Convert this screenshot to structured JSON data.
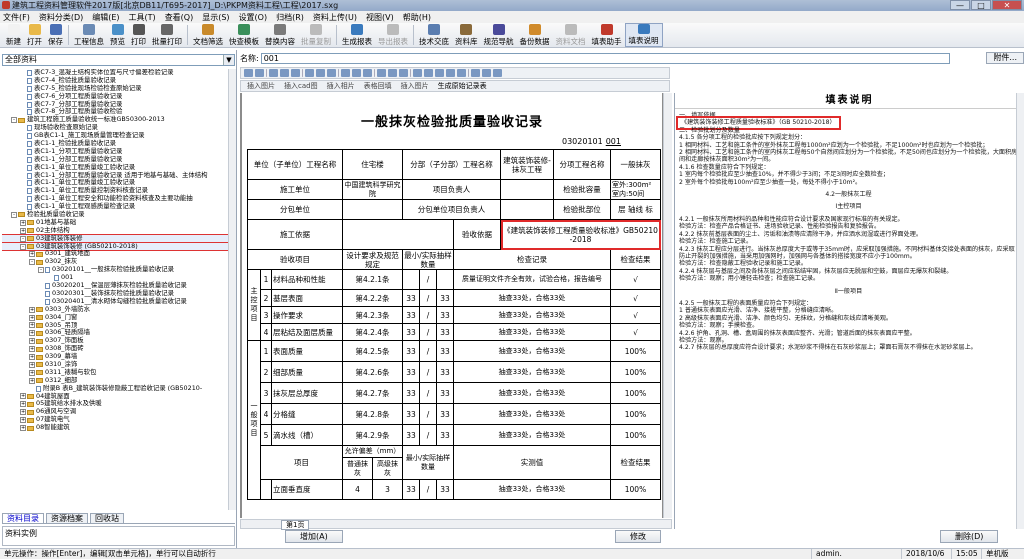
{
  "window": {
    "title": "建筑工程资料管理软件2017版[北京DB11/T695-2017]_D:\\PKPM资料工程\\工程\\2017.sxg",
    "min": "—",
    "max": "□",
    "close": "✕"
  },
  "menu": [
    "文件(F)",
    "资料分类(D)",
    "编辑(E)",
    "工具(T)",
    "查看(Q)",
    "显示(S)",
    "设置(O)",
    "归档(R)",
    "资料上传(U)",
    "视图(V)",
    "帮助(H)"
  ],
  "toolbar": [
    {
      "label": "新建",
      "color": "#f2f2f2"
    },
    {
      "label": "打开",
      "color": "#e9b949"
    },
    {
      "label": "保存",
      "color": "#4a6fb5"
    },
    {
      "sep": true
    },
    {
      "label": "工程信息",
      "color": "#6b8bb5"
    },
    {
      "label": "预览",
      "color": "#4a90c8"
    },
    {
      "label": "打印",
      "color": "#555"
    },
    {
      "label": "批量打印",
      "color": "#666"
    },
    {
      "sep": true
    },
    {
      "label": "文档筛选",
      "color": "#c98a2a"
    },
    {
      "label": "快查模板",
      "color": "#3a8f5a"
    },
    {
      "label": "替换内容",
      "color": "#7a7a7a"
    },
    {
      "label": "批量复制",
      "color": "#bbb",
      "dis": true
    },
    {
      "sep": true
    },
    {
      "label": "生成报表",
      "color": "#3a7abd"
    },
    {
      "label": "导出报表",
      "color": "#bbb",
      "dis": true
    },
    {
      "sep": true
    },
    {
      "label": "技术交底",
      "color": "#5a7db0"
    },
    {
      "label": "资料库",
      "color": "#8a6a3a"
    },
    {
      "label": "规范导航",
      "color": "#4a4a9a"
    },
    {
      "label": "备份数据",
      "color": "#d08a2a"
    },
    {
      "label": "资料文档",
      "color": "#bbb",
      "dis": true
    },
    {
      "label": "填表助手",
      "color": "#c0392b"
    },
    {
      "label": "填表说明",
      "color": "#3a7abd",
      "active": true
    }
  ],
  "left": {
    "combo": "全部资料",
    "tree": [
      {
        "i": 2,
        "t": "表C7-3_混凝土结构实体位置与尺寸偏差检验记录",
        "k": "dc"
      },
      {
        "i": 2,
        "t": "表C7-4_检验批质量验收记录",
        "k": "dc"
      },
      {
        "i": 2,
        "t": "表C7-5_检验批现场检验检查原始记录",
        "k": "dc"
      },
      {
        "i": 2,
        "t": "表C7-6_分项工程质量验收记录",
        "k": "dc"
      },
      {
        "i": 2,
        "t": "表C7-7_分部工程质量验收记录",
        "k": "dc"
      },
      {
        "i": 2,
        "t": "表C7-8_分部工程质量验收检验",
        "k": "dc"
      },
      {
        "i": 1,
        "t": "建筑工程施工质量验收统一标准GB50300-2013",
        "k": "fd",
        "pm": "-"
      },
      {
        "i": 2,
        "t": "现场验收检查原始记录",
        "k": "dc"
      },
      {
        "i": 2,
        "t": "GB表C1-1_施工现场质量管理检查记录",
        "k": "dc"
      },
      {
        "i": 2,
        "t": "表C1-1_检验批质量验收记录",
        "k": "dc"
      },
      {
        "i": 2,
        "t": "表C1-1_分项工程质量验收记录",
        "k": "dc"
      },
      {
        "i": 2,
        "t": "表C1-1_分部工程质量验收记录",
        "k": "dc"
      },
      {
        "i": 2,
        "t": "表C1-1_单位工程质量竣工验收记录",
        "k": "dc"
      },
      {
        "i": 2,
        "t": "表C1-1_分部工程质量验收记录 适用于地基与基础、主体结构",
        "k": "dc"
      },
      {
        "i": 2,
        "t": "表C1-1_单位工程质量竣工验收记录",
        "k": "dc"
      },
      {
        "i": 2,
        "t": "表C1-1_单位工程质量控制资料核查记录",
        "k": "dc"
      },
      {
        "i": 2,
        "t": "表C1-1_单位工程安全和功能检验资料核查及主要功能抽",
        "k": "dc"
      },
      {
        "i": 2,
        "t": "表C1-1_单位工程观感质量检查记录",
        "k": "dc"
      },
      {
        "i": 1,
        "t": "检验批质量验收记录",
        "k": "fd",
        "pm": "-"
      },
      {
        "i": 2,
        "t": "01地基与基础",
        "k": "fd",
        "pm": "+"
      },
      {
        "i": 2,
        "t": "02主体结构",
        "k": "fd",
        "pm": "+"
      },
      {
        "i": 2,
        "t": "03建筑装饰装修",
        "k": "fd",
        "pm": "-",
        "sel": true
      },
      {
        "i": 2,
        "t": "03建筑装饰装修 (GB50210-2018)",
        "k": "fd",
        "pm": "-",
        "sel": true
      },
      {
        "i": 3,
        "t": "0301_建筑地面",
        "k": "fd",
        "pm": "+"
      },
      {
        "i": 3,
        "t": "0302_抹灰",
        "k": "fd",
        "pm": "-"
      },
      {
        "i": 4,
        "t": "03020101__一般抹灰检验批质量验收记录",
        "k": "dc",
        "pm": "-"
      },
      {
        "i": 5,
        "t": "001",
        "k": "dc"
      },
      {
        "i": 4,
        "t": "03020201__保温层薄抹灰检验批质量验收记录",
        "k": "dc"
      },
      {
        "i": 4,
        "t": "03020301__装饰抹灰检验批质量验收记录",
        "k": "dc"
      },
      {
        "i": 4,
        "t": "03020401__清水砌体勾缝检验批质量验收记录",
        "k": "dc"
      },
      {
        "i": 3,
        "t": "0303_外墙防水",
        "k": "fd",
        "pm": "+"
      },
      {
        "i": 3,
        "t": "0304_门窗",
        "k": "fd",
        "pm": "+"
      },
      {
        "i": 3,
        "t": "0305_吊顶",
        "k": "fd",
        "pm": "+"
      },
      {
        "i": 3,
        "t": "0306_轻质隔墙",
        "k": "fd",
        "pm": "+"
      },
      {
        "i": 3,
        "t": "0307_饰面板",
        "k": "fd",
        "pm": "+"
      },
      {
        "i": 3,
        "t": "0308_饰面砖",
        "k": "fd",
        "pm": "+"
      },
      {
        "i": 3,
        "t": "0309_幕墙",
        "k": "fd",
        "pm": "+"
      },
      {
        "i": 3,
        "t": "0310_涂饰",
        "k": "fd",
        "pm": "+"
      },
      {
        "i": 3,
        "t": "0311_裱糊与软包",
        "k": "fd",
        "pm": "+"
      },
      {
        "i": 3,
        "t": "0312_细部",
        "k": "fd",
        "pm": "+"
      },
      {
        "i": 3,
        "t": "附录B 表B_建筑装饰装修隐蔽工程验收记录 (GB50210-",
        "k": "dc"
      },
      {
        "i": 2,
        "t": "04建筑屋面",
        "k": "fd",
        "pm": "+"
      },
      {
        "i": 2,
        "t": "05建筑给水排水及供暖",
        "k": "fd",
        "pm": "+"
      },
      {
        "i": 2,
        "t": "06通风与空调",
        "k": "fd",
        "pm": "+"
      },
      {
        "i": 2,
        "t": "07建筑电气",
        "k": "fd",
        "pm": "+"
      },
      {
        "i": 2,
        "t": "08智能建筑",
        "k": "fd",
        "pm": "+"
      }
    ],
    "tabs": [
      "资料目录",
      "资源档案",
      "回收站"
    ],
    "panel_title": "资料实例"
  },
  "name_row": {
    "label": "名称:",
    "value": "001",
    "attach": "附件..."
  },
  "form_tools": {
    "gen_label": "生成原始记录表",
    "items": [
      "插入图片",
      "插入cad图",
      "插入相片",
      "表格回填",
      "插入图片"
    ]
  },
  "form": {
    "title": "一般抹灰检验批质量验收记录",
    "code": "03020101",
    "serial": "001",
    "r1": {
      "unit_label": "单位（子单位）工程名称",
      "unit_value": "住宅楼",
      "part_label": "分部（子分部）工程名称",
      "part_value": "建筑装饰装修-抹灰工程",
      "item_label": "分项工程名称",
      "item_value": "一般抹灰"
    },
    "r2": {
      "contractor_label": "施工单位",
      "contractor_value": "中国建筑科学研究院",
      "pm_label": "项目负责人",
      "capacity_label": "检验批容量",
      "capacity_value": "室外:300m²  室内:50间"
    },
    "r3": {
      "sub_label": "分包单位",
      "sub_pm_label": "分包单位项目负责人",
      "pos_label": "检验批部位",
      "pos_value": "层  轴线  标"
    },
    "r4": {
      "basis_label": "施工依据",
      "accept_label": "验收依据",
      "accept_value": "《建筑装饰装修工程质量验收标准》GB50210-2018"
    },
    "head": {
      "item": "验收项目",
      "req": "设计要求及规范规定",
      "min": "最小/实际抽样数量",
      "record": "检查记录",
      "result": "检查结果"
    },
    "main_label": "主控项目",
    "gen_label": "一般项目",
    "main_rows": [
      {
        "n": "1",
        "name": "材料品种和性能",
        "clause": "第4.2.1条",
        "min": "",
        "act": "",
        "record": "质量证明文件齐全有效，试验合格，报告编号",
        "res": "√"
      },
      {
        "n": "2",
        "name": "基层表面",
        "clause": "第4.2.2条",
        "min": "33",
        "act": "33",
        "record": "抽查33处，合格33处",
        "res": "√"
      },
      {
        "n": "3",
        "name": "操作要求",
        "clause": "第4.2.3条",
        "min": "33",
        "act": "33",
        "record": "抽查33处，合格33处",
        "res": "√"
      },
      {
        "n": "4",
        "name": "层粘结及面层质量",
        "clause": "第4.2.4条",
        "min": "33",
        "act": "33",
        "record": "抽查33处，合格33处",
        "res": "√"
      }
    ],
    "gen_rows": [
      {
        "n": "1",
        "name": "表面质量",
        "clause": "第4.2.5条",
        "min": "33",
        "act": "33",
        "record": "抽查33处，合格33处",
        "res": "100%"
      },
      {
        "n": "2",
        "name": "细部质量",
        "clause": "第4.2.6条",
        "min": "33",
        "act": "33",
        "record": "抽查33处，合格33处",
        "res": "100%"
      },
      {
        "n": "3",
        "name": "抹灰层总厚度",
        "clause": "第4.2.7条",
        "min": "33",
        "act": "33",
        "record": "抽查33处，合格33处",
        "res": "100%"
      },
      {
        "n": "4",
        "name": "分格缝",
        "clause": "第4.2.8条",
        "min": "33",
        "act": "33",
        "record": "抽查33处，合格33处",
        "res": "100%"
      },
      {
        "n": "5",
        "name": "滴水线（槽）",
        "clause": "第4.2.9条",
        "min": "33",
        "act": "33",
        "record": "抽查33处，合格33处",
        "res": "100%"
      }
    ],
    "sub_head": {
      "item": "项目",
      "dev": "允许偏差（mm）",
      "normal": "普通抹灰",
      "high": "高级抹灰",
      "min": "最小/实际抽样数量",
      "measured": "实测值",
      "result": "检查结果"
    },
    "last_row": {
      "name": "立面垂直度",
      "normal": "4",
      "high": "3",
      "min": "33",
      "act": "33",
      "record": "抽查33处，合格33处",
      "res": "100%"
    }
  },
  "sheet_tab": "第1页",
  "help": {
    "title": "填表说明",
    "lines": [
      {
        "t": "一、填写依据",
        "c": ""
      },
      {
        "t": "《建筑装饰装修工程质量验收标准》（GB 50210-2018）",
        "c": "red"
      },
      {
        "t": "二、检验批划分及数量",
        "c": ""
      },
      {
        "t": "4.1.5 各分项工程的检验批应按下列规定划分：",
        "c": ""
      },
      {
        "t": "  1 相同材料、工艺和施工条件的室外抹灰工程每1000m²应划为一个检验批，不足1000m²时也应划为一个检验批；",
        "c": ""
      },
      {
        "t": "  2 相同材料、工艺和施工条件的室内抹灰工程每50个自然间应划分为一个检验批，不足50间也应划分为一个检验批，大面积房间和走廊按抹灰面积30m²为一间。",
        "c": ""
      },
      {
        "t": "4.1.6 检查数量应符合下列规定：",
        "c": ""
      },
      {
        "t": "  1 室内每个检验批应至少抽查10%，并不得少于3间；不足3间时应全数检查；",
        "c": ""
      },
      {
        "t": "  2 室外每个检验批每100m²应至少抽查一处，每处不得小于10m²。",
        "c": ""
      },
      {
        "t": "4.2一般抹灰工程",
        "c": "center"
      },
      {
        "t": "Ⅰ主控项目",
        "c": "center"
      },
      {
        "t": "4.2.1 一般抹灰所用材料的品种和性能应符合设计要求及国家现行标准的有关规定。",
        "c": ""
      },
      {
        "t": "      检验方法：检查产品合格证书、进场验收记录、性能检验报告和复验报告。",
        "c": ""
      },
      {
        "t": "4.2.2 抹灰前基层表面的尘土、污垢和油渍等应清除干净，并应洒水润湿或进行界面处理。",
        "c": ""
      },
      {
        "t": "      检验方法：检查施工记录。",
        "c": ""
      },
      {
        "t": "4.2.3 抹灰工程应分层进行。当抹灰总厚度大于或等于35mm时，应采取加强措施。不同材料基体交接处表面的抹灰，应采取防止开裂的加强措施，当采用加强网时，加强网与各基体的搭接宽度不应小于100mm。",
        "c": ""
      },
      {
        "t": "      检验方法：检查隐蔽工程验收记录和施工记录。",
        "c": ""
      },
      {
        "t": "4.2.4 抹灰层与基层之间及各抹灰层之间应粘结牢固，抹灰层应无脱层和空鼓，面层应无爆灰和裂缝。",
        "c": ""
      },
      {
        "t": "      检验方法：观察；用小锤轻击检查；检查施工记录。",
        "c": ""
      },
      {
        "t": "Ⅱ一般项目",
        "c": "center"
      },
      {
        "t": "4.2.5 一般抹灰工程的表面质量应符合下列规定：",
        "c": ""
      },
      {
        "t": "  1 普通抹灰表面应光滑、洁净、接槎平整，分格缝应清晰。",
        "c": ""
      },
      {
        "t": "  2 高级抹灰表面应光滑、洁净、颜色均匀、无抹纹，分格缝和灰线应清晰美观。",
        "c": ""
      },
      {
        "t": "      检验方法：观察；手摸检查。",
        "c": ""
      },
      {
        "t": "4.2.6 护角、孔洞、槽、盒周围的抹灰表面应整齐、光滑；管道后面的抹灰表面应平整。",
        "c": ""
      },
      {
        "t": "      检验方法：观察。",
        "c": ""
      },
      {
        "t": "4.2.7 抹灰层的总厚度应符合设计要求；水泥砂浆不得抹在石灰砂浆层上；罩面石膏灰不得抹在水泥砂浆层上。",
        "c": ""
      }
    ]
  },
  "bottom": {
    "add": "增加(A)",
    "modify": "修改",
    "delete": "删除(D)"
  },
  "status": {
    "hint": "单元操作：操作[Enter]，编辑[双击单元格]，单行可以自动折行",
    "user": "admin.",
    "date": "2018/10/6",
    "time": "15:05",
    "machine": "单机版"
  }
}
